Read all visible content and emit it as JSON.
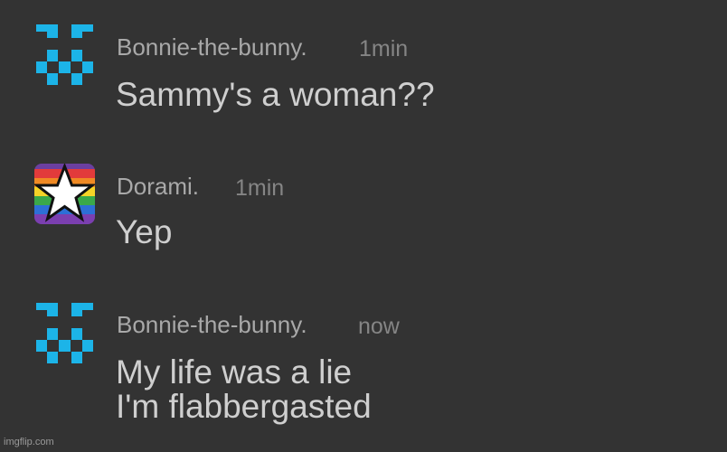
{
  "messages": [
    {
      "username": "Bonnie-the-bunny.",
      "timestamp": "1min",
      "avatar": "fnaf-pixel-eyes-icon",
      "lines": [
        "Sammy's a woman??"
      ]
    },
    {
      "username": "Dorami.",
      "timestamp": "1min",
      "avatar": "rainbow-star-icon",
      "lines": [
        "Yep"
      ]
    },
    {
      "username": "Bonnie-the-bunny.",
      "timestamp": "now",
      "avatar": "fnaf-pixel-eyes-icon",
      "lines": [
        "My life was a lie",
        "I'm flabbergasted"
      ]
    }
  ],
  "watermark": "imgflip.com",
  "colors": {
    "background": "#333333",
    "username": "#a9a9a9",
    "timestamp": "#858585",
    "message": "#cfcfcf",
    "pixel_avatar": "#1cb4e8"
  }
}
